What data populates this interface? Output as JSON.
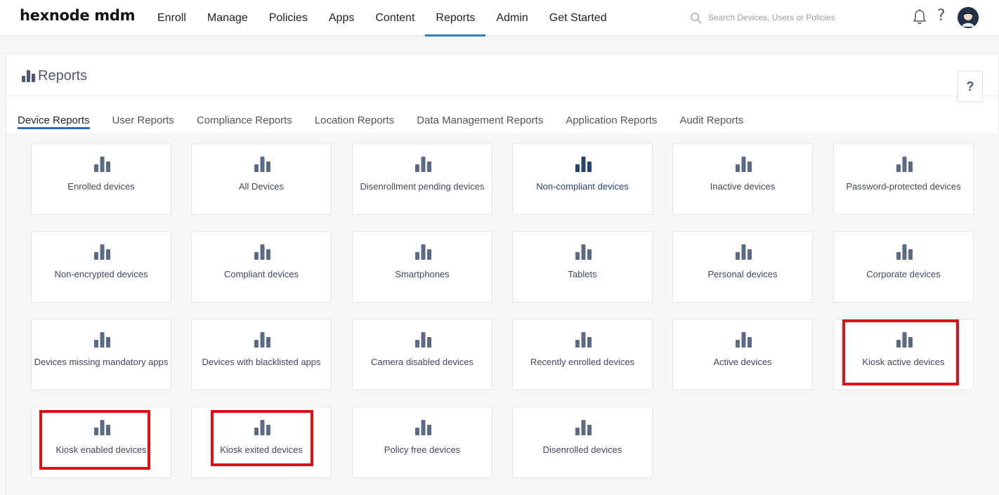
{
  "brand": "hexnode mdm",
  "nav": [
    "Enroll",
    "Manage",
    "Policies",
    "Apps",
    "Content",
    "Reports",
    "Admin",
    "Get Started"
  ],
  "nav_active": "Reports",
  "search": {
    "placeholder": "Search Devices, Users or Policies"
  },
  "page": {
    "title": "Reports",
    "help": "?"
  },
  "tabs": [
    "Device Reports",
    "User Reports",
    "Compliance Reports",
    "Location Reports",
    "Data Management Reports",
    "Application Reports",
    "Audit Reports"
  ],
  "tab_active": "Device Reports",
  "cards": [
    "Enrolled devices",
    "All Devices",
    "Disenrollment pending devices",
    "Non-compliant devices",
    "Inactive devices",
    "Password-protected devices",
    "Non-encrypted devices",
    "Compliant devices",
    "Smartphones",
    "Tablets",
    "Personal devices",
    "Corporate devices",
    "Devices missing mandatory apps",
    "Devices with blacklisted apps",
    "Camera disabled devices",
    "Recently enrolled devices",
    "Active devices",
    "Kiosk active devices",
    "Kiosk enabled devices",
    "Kiosk exited devices",
    "Policy free devices",
    "Disenrolled devices"
  ],
  "highlighted_card": "Non-compliant devices",
  "annotated_cards": [
    "Kiosk active devices",
    "Kiosk enabled devices",
    "Kiosk exited devices"
  ],
  "colors": {
    "accent": "#2f7fd6",
    "icon": "#5b6b86",
    "icon_active": "#24436e",
    "annotation": "#e0101a"
  }
}
